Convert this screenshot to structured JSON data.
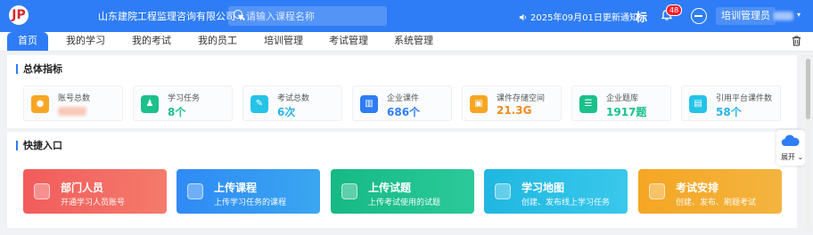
{
  "colors": {
    "brand": "#2f7df6",
    "orange": "#f5a623",
    "green": "#1bc08a",
    "cyan": "#25c3e8",
    "blue": "#2f7df6",
    "red": "#f25c5c",
    "cyan_value": "#2bb3e6",
    "green_value": "#1bc08a",
    "orange_value": "#f08b1e"
  },
  "header": {
    "logo_text": "JP",
    "company": "山东建院工程监理咨询有限公司",
    "search_placeholder": "请输入课程名称",
    "notice": "2025年09月01日更新通知",
    "icon_label": "标",
    "badge_count": "48",
    "role_button": "培训管理员",
    "icons": [
      "speaker-icon",
      "bell-icon",
      "user-circle-icon",
      "chevron-down-icon"
    ]
  },
  "nav": {
    "tabs": [
      {
        "label": "首页",
        "active": true
      },
      {
        "label": "我的学习"
      },
      {
        "label": "我的考试"
      },
      {
        "label": "我的员工"
      },
      {
        "label": "培训管理"
      },
      {
        "label": "考试管理"
      },
      {
        "label": "系统管理"
      }
    ]
  },
  "overview": {
    "title": "总体指标",
    "stats": [
      {
        "label": "账号总数",
        "value": "",
        "icon": "user-icon"
      },
      {
        "label": "学习任务",
        "value": "8个",
        "icon": "task-icon"
      },
      {
        "label": "考试总数",
        "value": "6次",
        "icon": "exam-icon"
      },
      {
        "label": "企业课件",
        "value": "686个",
        "icon": "book-icon"
      },
      {
        "label": "课件存储空间",
        "value": "21.3G",
        "icon": "storage-icon"
      },
      {
        "label": "企业题库",
        "value": "1917题",
        "icon": "list-icon"
      },
      {
        "label": "引用平台课件数",
        "value": "58个",
        "icon": "document-icon"
      }
    ]
  },
  "quick": {
    "title": "快捷入口",
    "cards": [
      {
        "title": "部门人员",
        "subtitle": "开通学习人员账号"
      },
      {
        "title": "上传课程",
        "subtitle": "上传学习任务的课程"
      },
      {
        "title": "上传试题",
        "subtitle": "上传考试使用的试题"
      },
      {
        "title": "学习地图",
        "subtitle": "创建、发布线上学习任务"
      },
      {
        "title": "考试安排",
        "subtitle": "创建、发布、刷题考试"
      }
    ]
  },
  "widget": {
    "label": "展开",
    "icon": "cloud-icon"
  }
}
